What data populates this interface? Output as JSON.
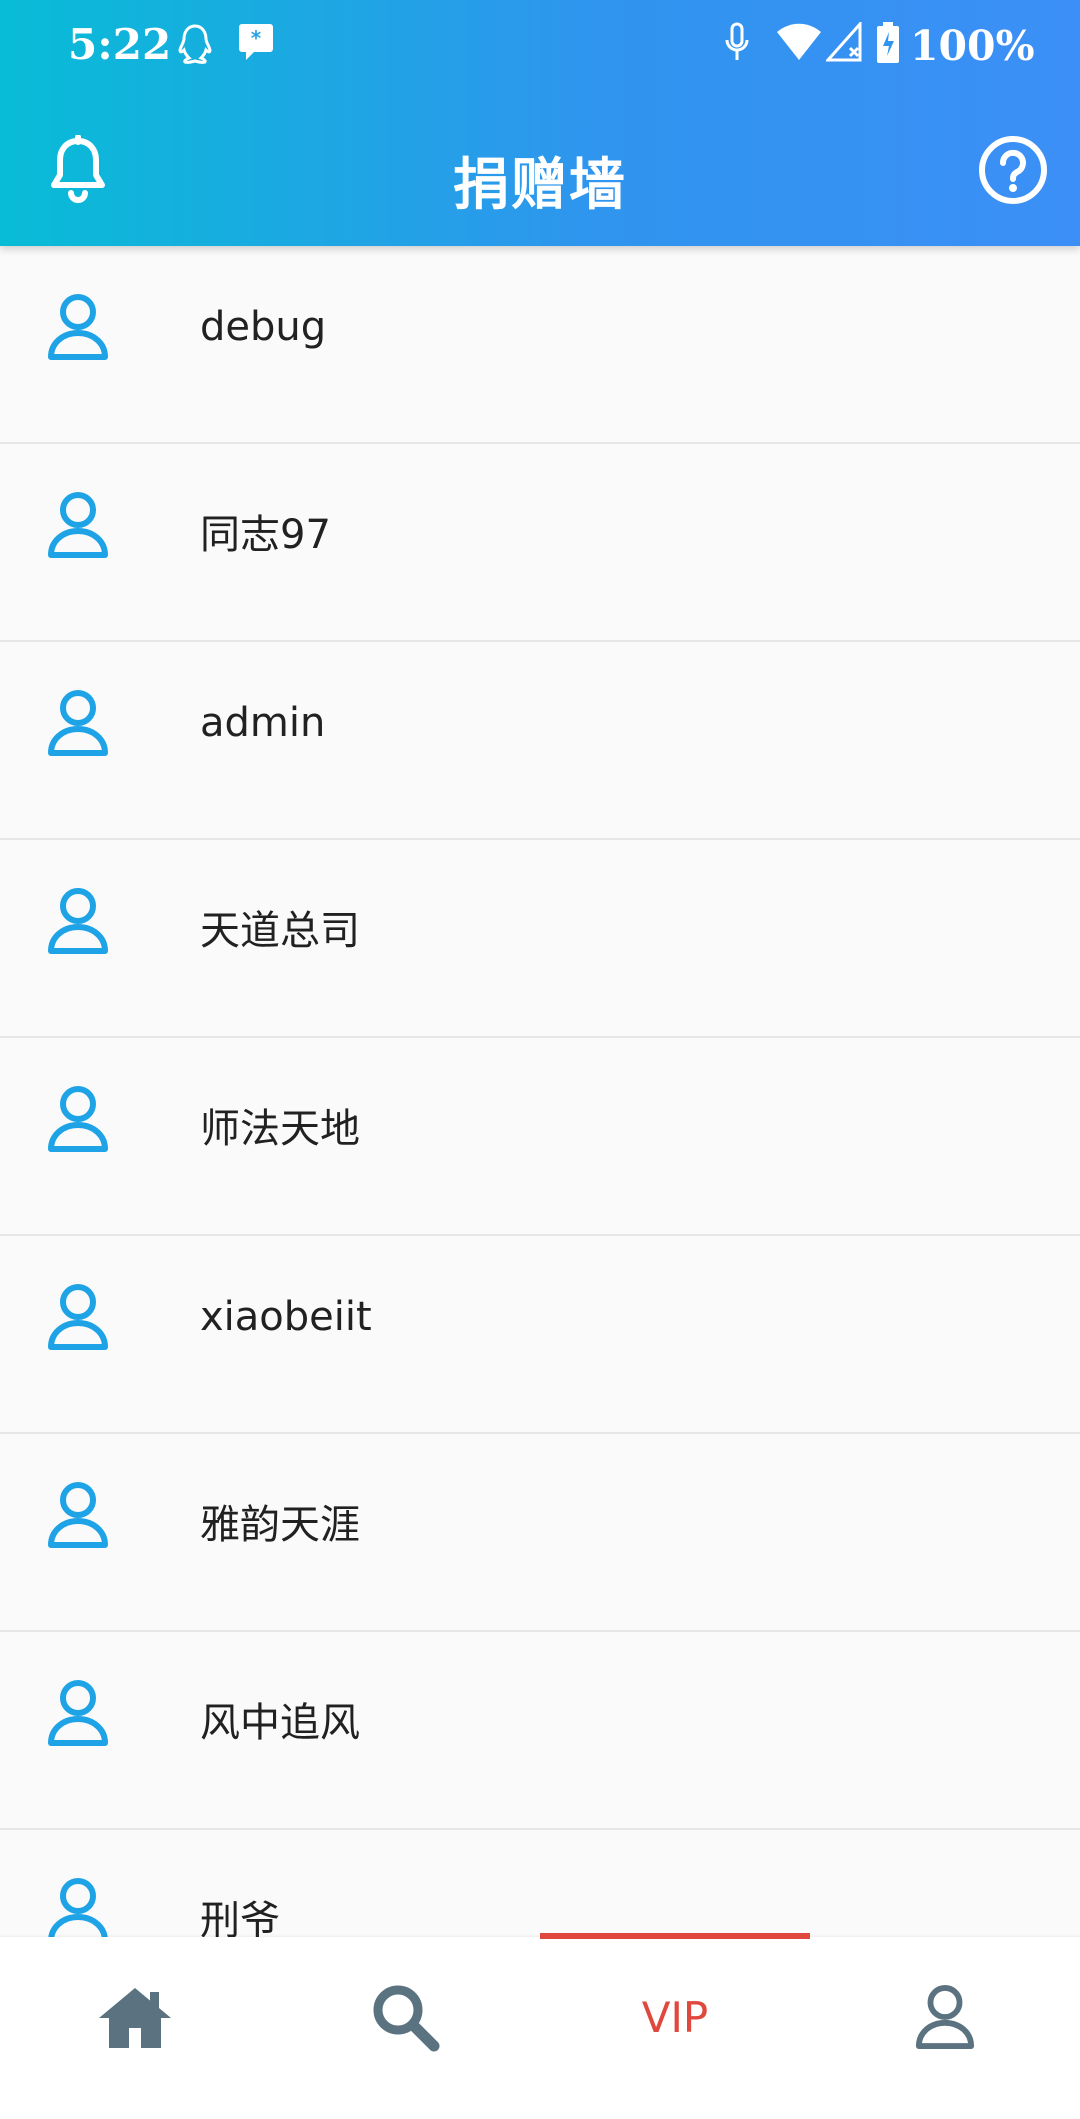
{
  "status_bar": {
    "time": "5:22",
    "battery": "100%",
    "icons": [
      "qq-icon",
      "chat-icon",
      "mic-icon",
      "wifi-icon",
      "signal-icon",
      "battery-icon"
    ]
  },
  "app_bar": {
    "title": "捐赠墙",
    "left_icon": "bell-icon",
    "right_icon": "help-icon"
  },
  "donors": [
    {
      "name": "debug"
    },
    {
      "name": "同志97"
    },
    {
      "name": "admin"
    },
    {
      "name": "天道总司"
    },
    {
      "name": "师法天地"
    },
    {
      "name": "xiaobeiit"
    },
    {
      "name": "雅韵天涯"
    },
    {
      "name": "风中追风"
    },
    {
      "name": "刑爷"
    }
  ],
  "bottom_nav": {
    "items": [
      {
        "icon": "home-icon"
      },
      {
        "icon": "search-icon"
      },
      {
        "label": "VIP",
        "active": true
      },
      {
        "icon": "user-icon"
      }
    ]
  },
  "colors": {
    "accent_blue": "#1ea3e6",
    "active_red": "#e0473d",
    "nav_icon_gray": "#5b7280"
  }
}
